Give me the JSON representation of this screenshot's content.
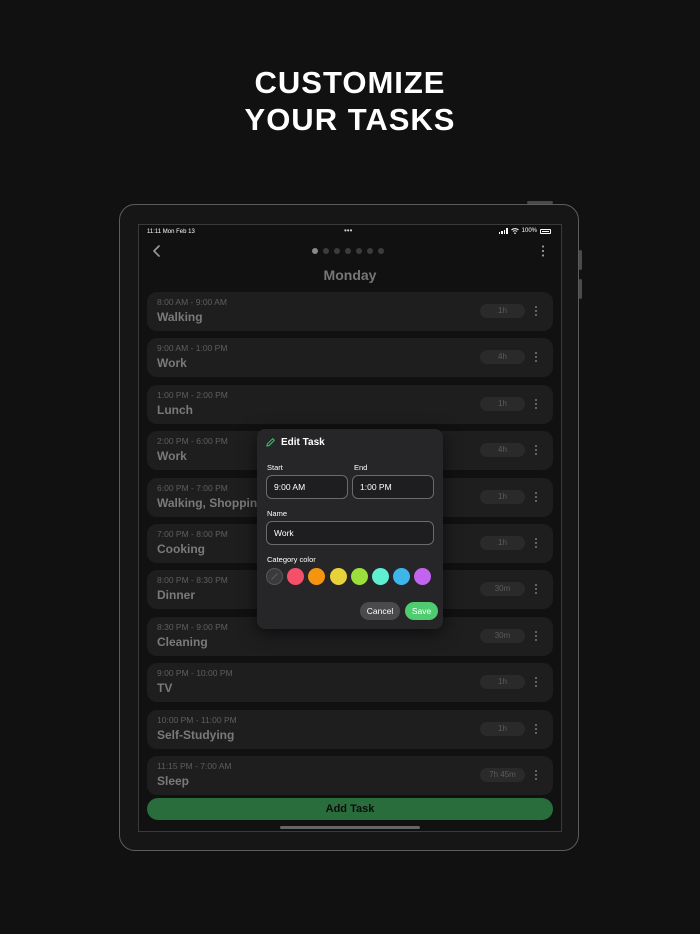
{
  "headline": {
    "line1": "CUSTOMIZE",
    "line2": "YOUR TASKS"
  },
  "status_bar": {
    "time": "11:11  Mon Feb 13",
    "multitask_dots": "•••",
    "battery": "100%"
  },
  "pager": {
    "count": 7,
    "active": 0
  },
  "day_title": "Monday",
  "tasks": [
    {
      "time": "8:00 AM - 9:00 AM",
      "name": "Walking",
      "duration": "1h"
    },
    {
      "time": "9:00 AM - 1:00 PM",
      "name": "Work",
      "duration": "4h"
    },
    {
      "time": "1:00 PM - 2:00 PM",
      "name": "Lunch",
      "duration": "1h"
    },
    {
      "time": "2:00 PM - 6:00 PM",
      "name": "Work",
      "duration": "4h"
    },
    {
      "time": "6:00 PM - 7:00 PM",
      "name": "Walking, Shopping",
      "duration": "1h"
    },
    {
      "time": "7:00 PM - 8:00 PM",
      "name": "Cooking",
      "duration": "1h"
    },
    {
      "time": "8:00 PM - 8:30 PM",
      "name": "Dinner",
      "duration": "30m"
    },
    {
      "time": "8:30 PM - 9:00 PM",
      "name": "Cleaning",
      "duration": "30m"
    },
    {
      "time": "9:00 PM - 10:00 PM",
      "name": "TV",
      "duration": "1h"
    },
    {
      "time": "10:00 PM - 11:00 PM",
      "name": "Self-Studying",
      "duration": "1h"
    },
    {
      "time": "11:15 PM - 7:00 AM",
      "name": "Sleep",
      "duration": "7h 45m"
    }
  ],
  "add_task_label": "Add Task",
  "edit_dialog": {
    "title": "Edit Task",
    "start_label": "Start",
    "start_value": "9:00 AM",
    "end_label": "End",
    "end_value": "1:00 PM",
    "name_label": "Name",
    "name_value": "Work",
    "color_label": "Category color",
    "colors": [
      "#3a3a3c",
      "#f5506a",
      "#f5940f",
      "#e8d23a",
      "#9cdf3c",
      "#5ef0d0",
      "#3fb6ea",
      "#c264f0"
    ],
    "selected_color": 0,
    "cancel_label": "Cancel",
    "save_label": "Save"
  },
  "colors": {
    "accent_green": "#4fcc70",
    "add_button": "#2a6d3c"
  }
}
